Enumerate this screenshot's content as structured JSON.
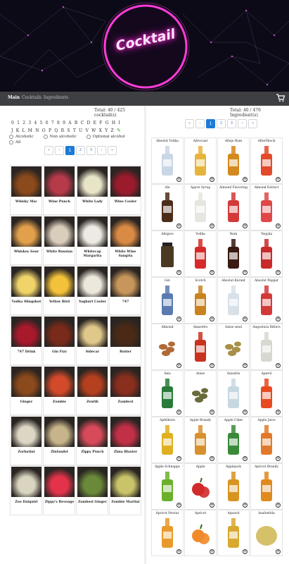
{
  "brand": {
    "logo_text": "Cocktail"
  },
  "nav": {
    "main": "Main",
    "cocktails": "Cocktails",
    "ingredients": "Ingredients",
    "cart_icon": "shopping-cart-icon"
  },
  "cocktails_panel": {
    "total": "Total: 40 / 425 cocktail(s)",
    "letters_row1": "0 1 2 3 4 5 6 7 8 9 A B C D E F G H I",
    "letters_row2": "J K L M N O P Q R S T U V W X Y Z",
    "filters": [
      "Alcoholic",
      "Non alcoholic",
      "Optional alcohol",
      "All"
    ],
    "pagination": [
      "«",
      "‹",
      "1",
      "2",
      "3",
      "›",
      "»"
    ],
    "active_page": "1",
    "items": [
      {
        "name": "Whisky Mac",
        "color": "#8b4a1c"
      },
      {
        "name": "Wine Punch",
        "color": "#b73a4b"
      },
      {
        "name": "White Lady",
        "color": "#e8e4c8"
      },
      {
        "name": "Wine Cooler",
        "color": "#9b1b2c"
      },
      {
        "name": "Whiskey Sour",
        "color": "#e2a04b"
      },
      {
        "name": "White Russian",
        "color": "#d9cdbb"
      },
      {
        "name": "Whitecap Margarita",
        "color": "#eceae2"
      },
      {
        "name": "White Wine Sangria",
        "color": "#d98a45"
      },
      {
        "name": "Vodka Slingshot",
        "color": "#f0d46a"
      },
      {
        "name": "Yellow Bird",
        "color": "#f3c23a"
      },
      {
        "name": "Yoghurt Cooler",
        "color": "#ece8dc"
      },
      {
        "name": "747",
        "color": "#c7965b"
      },
      {
        "name": "747 Drink",
        "color": "#a8192c"
      },
      {
        "name": "Gin Fizz",
        "color": "#7a2a1a"
      },
      {
        "name": "Sidecar",
        "color": "#e0c78a"
      },
      {
        "name": "Butter",
        "color": "#4a2a16"
      },
      {
        "name": "Ginger",
        "color": "#8b4a1c"
      },
      {
        "name": "Zombie",
        "color": "#d24a2a"
      },
      {
        "name": "Zenith",
        "color": "#b5401f"
      },
      {
        "name": "Zambezi",
        "color": "#8a2e1e"
      },
      {
        "name": "Zorbatini",
        "color": "#dcd6c4"
      },
      {
        "name": "Zinfandel",
        "color": "#c7b48a"
      },
      {
        "name": "Zippy Punch",
        "color": "#d64a5a"
      },
      {
        "name": "Zima Blaster",
        "color": "#c23048"
      },
      {
        "name": "Zoo Daiquiri",
        "color": "#d9d5c0"
      },
      {
        "name": "Zippy's Revenge",
        "color": "#e4324a"
      },
      {
        "name": "Zambesi Ginger",
        "color": "#6a8a3a"
      },
      {
        "name": "Zombie Martini",
        "color": "#c9c46a"
      }
    ]
  },
  "ingredients_panel": {
    "total": "Total: 40 / 476 Ingredient(s)",
    "pagination": [
      "«",
      "‹",
      "1",
      "2",
      "3",
      "›",
      "»"
    ],
    "active_page": "1",
    "items": [
      {
        "name": "Absolut Vodka",
        "color": "#c9d6e6",
        "shape": "bottle"
      },
      {
        "name": "Advocaat",
        "color": "#e6b43a",
        "shape": "bottle"
      },
      {
        "name": "Añejo Rum",
        "color": "#d28a1e",
        "shape": "bottle"
      },
      {
        "name": "AfterShock",
        "color": "#e24a2a",
        "shape": "bottle"
      },
      {
        "name": "Ale",
        "color": "#4a2e1a",
        "shape": "bottle"
      },
      {
        "name": "Agave Syrup",
        "color": "#e6e6e0",
        "shape": "bottle"
      },
      {
        "name": "Almond Flavoring",
        "color": "#d23a3a",
        "shape": "bottle"
      },
      {
        "name": "Almond Extract",
        "color": "#e04848",
        "shape": "bottle"
      },
      {
        "name": "Allspice",
        "color": "#4a3a22",
        "shape": "jar"
      },
      {
        "name": "Vodka",
        "color": "#d62a2a",
        "shape": "bottle"
      },
      {
        "name": "Rum",
        "color": "#3a1a12",
        "shape": "bottle"
      },
      {
        "name": "Tequila",
        "color": "#c82a2a",
        "shape": "bottle"
      },
      {
        "name": "Gin",
        "color": "#5a7ab0",
        "shape": "bottle"
      },
      {
        "name": "Scotch",
        "color": "#c8821e",
        "shape": "bottle"
      },
      {
        "name": "Absolut Kurant",
        "color": "#d8e0e8",
        "shape": "bottle"
      },
      {
        "name": "Absolut Peppar",
        "color": "#d23a3a",
        "shape": "bottle"
      },
      {
        "name": "Almond",
        "color": "#b06a36",
        "shape": "nuts"
      },
      {
        "name": "Amaretto",
        "color": "#c8321e",
        "shape": "bottle"
      },
      {
        "name": "Anise seed",
        "color": "#a89048",
        "shape": "nuts"
      },
      {
        "name": "Angostura Bitters",
        "color": "#d8d8d0",
        "shape": "bottle"
      },
      {
        "name": "Anis",
        "color": "#2a7a3a",
        "shape": "bottle"
      },
      {
        "name": "Anise",
        "color": "#6a6a3a",
        "shape": "nuts"
      },
      {
        "name": "Anisette",
        "color": "#c8d8e0",
        "shape": "bottle"
      },
      {
        "name": "Aperol",
        "color": "#e64a1e",
        "shape": "bottle"
      },
      {
        "name": "Apfelkorn",
        "color": "#e0b020",
        "shape": "bottle"
      },
      {
        "name": "Apple Brandy",
        "color": "#d8902e",
        "shape": "bottle"
      },
      {
        "name": "Apple Cider",
        "color": "#3a8a3a",
        "shape": "bottle"
      },
      {
        "name": "Apple Juice",
        "color": "#e07a2a",
        "shape": "bottle"
      },
      {
        "name": "Apple Schnapps",
        "color": "#6ab02a",
        "shape": "bottle"
      },
      {
        "name": "Apple",
        "color": "#d02a2a",
        "shape": "fruit"
      },
      {
        "name": "Applejack",
        "color": "#d89420",
        "shape": "bottle"
      },
      {
        "name": "Apricot Brandy",
        "color": "#e08a1e",
        "shape": "bottle"
      },
      {
        "name": "Apricot Nectar",
        "color": "#e89a2a",
        "shape": "bottle"
      },
      {
        "name": "Apricot",
        "color": "#f08a2a",
        "shape": "fruit"
      },
      {
        "name": "Aquavit",
        "color": "#d8a830",
        "shape": "bottle"
      },
      {
        "name": "Asafoetida",
        "color": "#d6c06a",
        "shape": "powder"
      }
    ]
  }
}
